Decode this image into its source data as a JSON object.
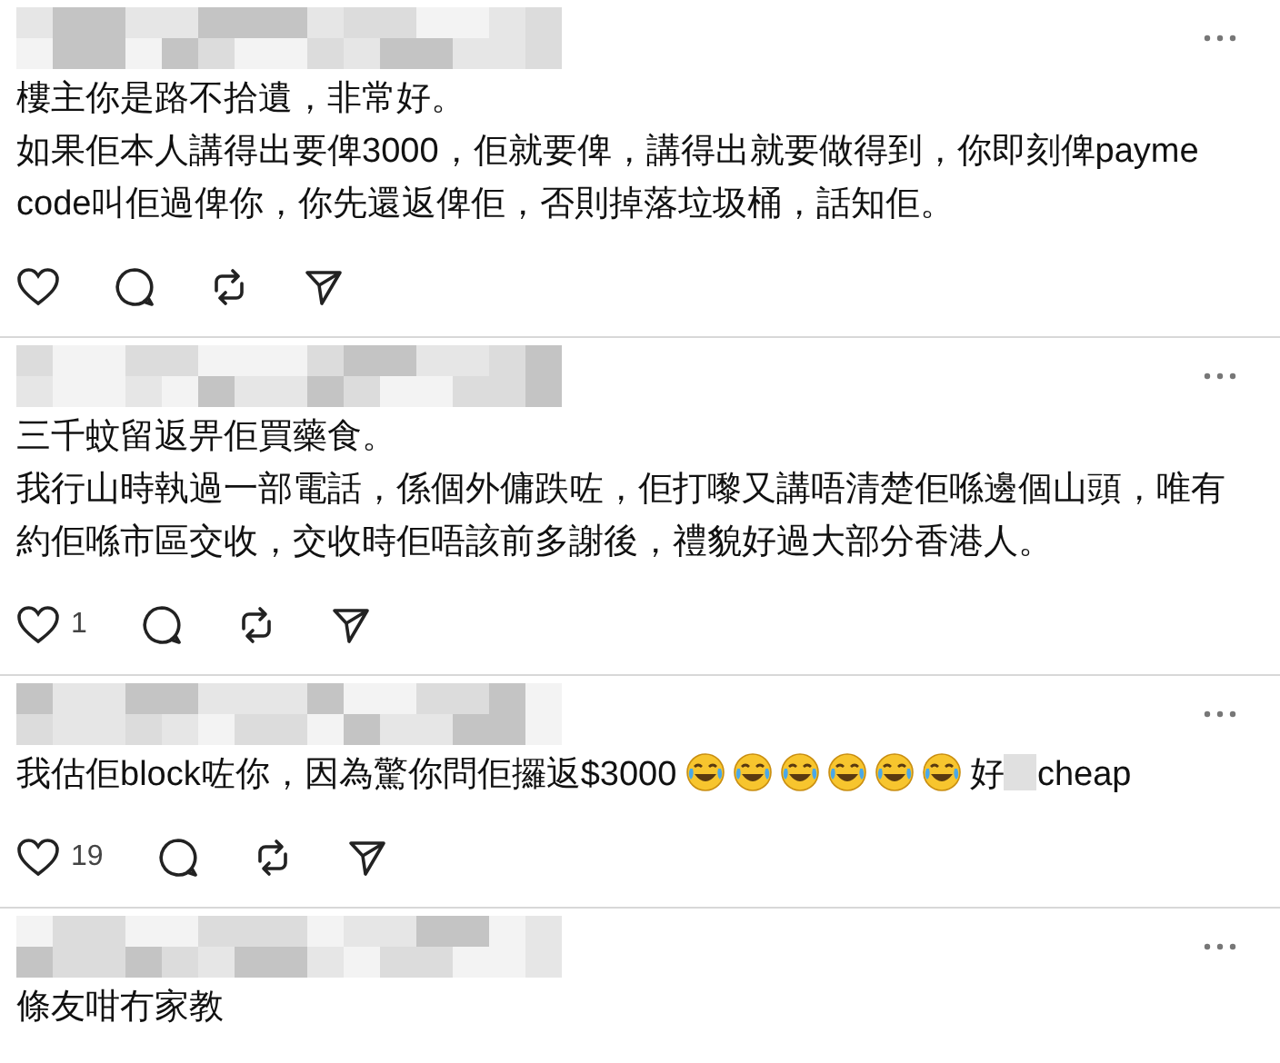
{
  "comments": [
    {
      "paragraphs": [
        [
          {
            "kind": "text",
            "text": "樓主你是路不拾遺，非常好。"
          }
        ],
        [
          {
            "kind": "text",
            "text": "如果佢本人講得出要俾3000，佢就要俾，講得出就要做得到，你即刻俾payme code叫佢過俾你，你先還返俾佢，否則掉落垃圾桶，話知佢。"
          }
        ]
      ]
    },
    {
      "paragraphs": [
        [
          {
            "kind": "text",
            "text": "三千蚊留返畀佢買藥食。"
          }
        ],
        [
          {
            "kind": "text",
            "text": "我行山時執過一部電話，係個外傭跌咗，佢打嚟又講唔清楚佢喺邊個山頭，唯有約佢喺市區交收，交收時佢唔該前多謝後，禮貌好過大部分香港人。"
          }
        ]
      ],
      "likes": "1"
    },
    {
      "paragraphs": [
        [
          {
            "kind": "text",
            "text": "我估佢block咗你，因為驚你問佢攞返$3000 "
          },
          {
            "kind": "emoji"
          },
          {
            "kind": "emoji"
          },
          {
            "kind": "emoji"
          },
          {
            "kind": "emoji"
          },
          {
            "kind": "emoji"
          },
          {
            "kind": "emoji"
          },
          {
            "kind": "text",
            "text": "好"
          },
          {
            "kind": "redacted"
          },
          {
            "kind": "text",
            "text": "cheap"
          }
        ]
      ],
      "likes": "19"
    },
    {
      "paragraphs": [
        [
          {
            "kind": "text",
            "text": "條友咁冇家教"
          }
        ]
      ],
      "actions": false
    }
  ]
}
